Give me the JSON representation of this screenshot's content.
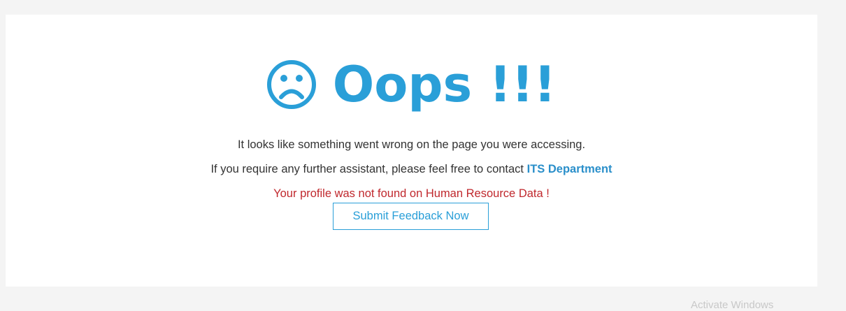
{
  "error": {
    "headline": "Oops !!!",
    "icon": "sad-face-icon",
    "message_line1": "It looks like something went wrong on the page you were accessing.",
    "message_line2_prefix": "If you require any further assistant, please feel free to contact ",
    "contact_link_label": "ITS Department",
    "error_detail": "Your profile was not found on Human Resource Data !",
    "feedback_button_label": "Submit Feedback Now"
  },
  "os_watermark": {
    "text": "Activate Windows"
  },
  "colors": {
    "accent": "#2a9fd8",
    "error_text": "#c0282d",
    "body_text": "#333333",
    "page_background": "#f4f4f4",
    "card_background": "#ffffff"
  }
}
